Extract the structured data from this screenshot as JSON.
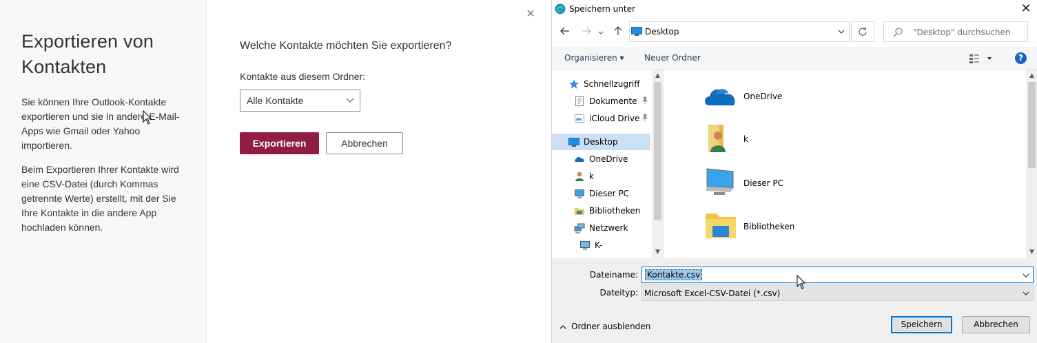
{
  "left_panel": {
    "title_line1": "Exportieren von",
    "title_line2": "Kontakten",
    "paragraph1": "Sie können Ihre Outlook-Kontakte exportieren und sie in andere E-Mail-Apps wie Gmail oder Yahoo importieren.",
    "paragraph2": "Beim Exportieren Ihrer Kontakte wird eine CSV-Datei (durch Kommas getrennte Werte) erstellt, mit der Sie Ihre Kontakte in die andere App hochladen können."
  },
  "export_form": {
    "close_symbol": "×",
    "question": "Welche Kontakte möchten Sie exportieren?",
    "folder_label": "Kontakte aus diesem Ordner:",
    "folder_selected": "Alle Kontakte",
    "export_button": "Exportieren",
    "cancel_button": "Abbrechen",
    "accent_color": "#8f1d45"
  },
  "save_dialog": {
    "title": "Speichern unter",
    "close_symbol": "✕",
    "address": "Desktop",
    "search_placeholder": "\"Desktop\" durchsuchen",
    "toolbar": {
      "organize": "Organisieren ▾",
      "new_folder": "Neuer Ordner",
      "help": "?"
    },
    "nav_items": [
      {
        "label": "Schnellzugriff",
        "icon": "star-icon"
      },
      {
        "label": "Dokumente",
        "icon": "document-icon",
        "pinned": true
      },
      {
        "label": "iCloud Drive",
        "icon": "cloud-icon",
        "pinned": true
      },
      {
        "label": "Desktop",
        "icon": "desktop-icon",
        "selected": true
      },
      {
        "label": "OneDrive",
        "icon": "onedrive-icon"
      },
      {
        "label": "k",
        "icon": "user-icon"
      },
      {
        "label": "Dieser PC",
        "icon": "computer-icon"
      },
      {
        "label": "Bibliotheken",
        "icon": "library-icon"
      },
      {
        "label": "Netzwerk",
        "icon": "network-icon"
      },
      {
        "label": "K-",
        "icon": "monitor-icon"
      }
    ],
    "content_items": [
      {
        "label": "OneDrive",
        "icon": "onedrive-icon"
      },
      {
        "label": "k",
        "icon": "user-folder-icon"
      },
      {
        "label": "Dieser PC",
        "icon": "computer-icon"
      },
      {
        "label": "Bibliotheken",
        "icon": "library-icon"
      }
    ],
    "filename_label": "Dateiname:",
    "filename_value": "Kontakte.csv",
    "filetype_label": "Dateityp:",
    "filetype_value": "Microsoft Excel-CSV-Datei (*.csv)",
    "hide_folders": "Ordner ausblenden",
    "save_button": "Speichern",
    "cancel_button": "Abbrechen"
  }
}
